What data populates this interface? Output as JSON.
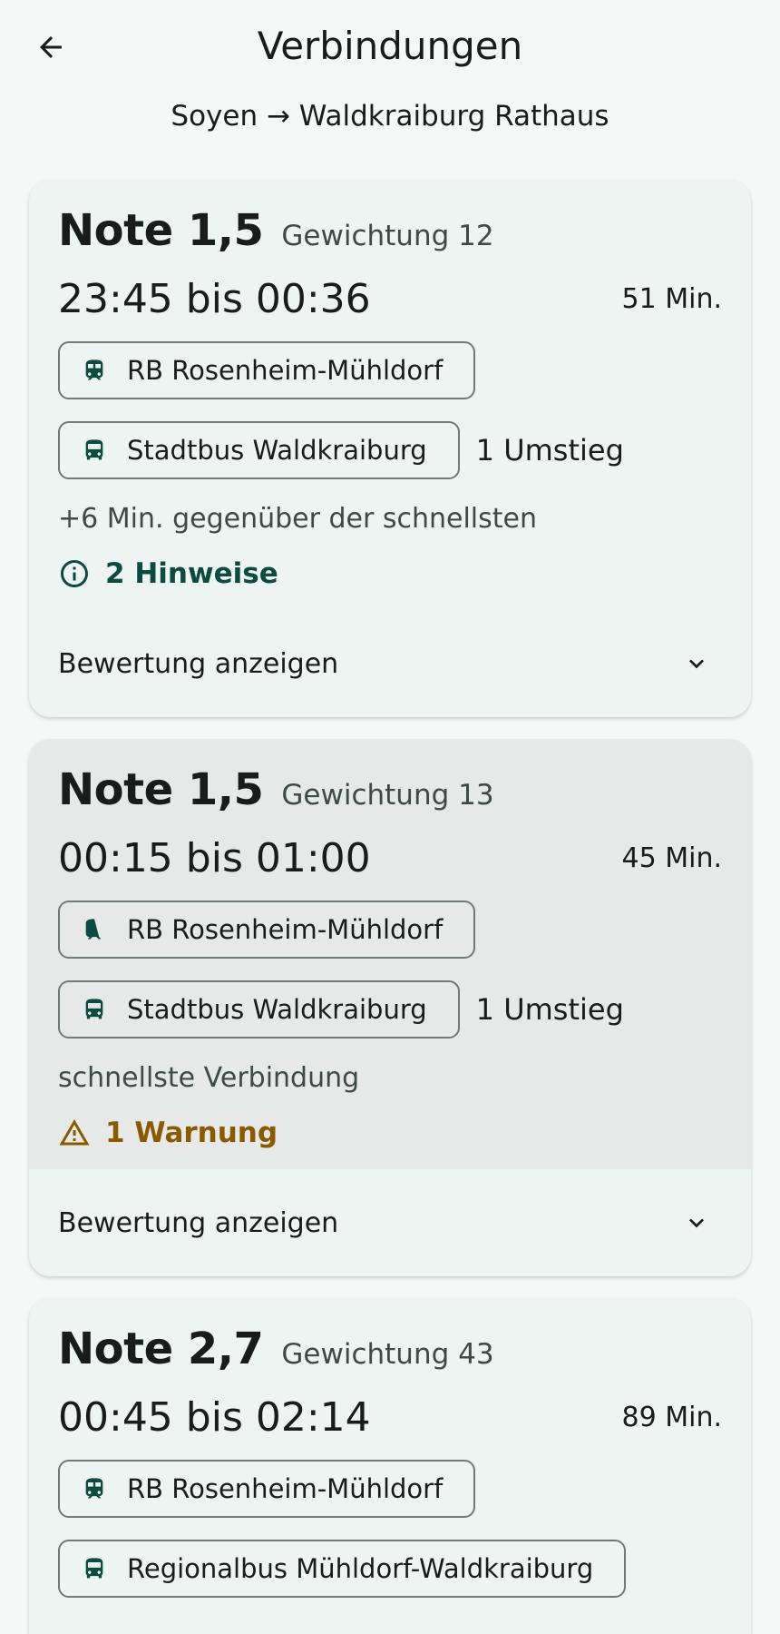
{
  "header": {
    "title": "Verbindungen",
    "route": "Soyen → Waldkraiburg Rathaus"
  },
  "colors": {
    "accent": "#0d4a40",
    "warning": "#8a5a00",
    "card_bg": "#eef4f2",
    "card_highlight_bg": "#e6e9e8"
  },
  "connections": [
    {
      "grade": "Note 1,5",
      "weight": "Gewichtung 12",
      "time": "23:45 bis 00:36",
      "duration": "51 Min.",
      "legs": [
        {
          "icon": "train-icon",
          "label": "RB Rosenheim-Mühldorf"
        },
        {
          "icon": "bus-icon",
          "label": "Stadtbus Waldkraiburg"
        }
      ],
      "transfers": "1 Umstieg",
      "note": "+6 Min. gegenüber der schnellsten",
      "hint": {
        "type": "info",
        "icon": "info-icon",
        "label": "2 Hinweise"
      },
      "expand_label": "Bewertung anzeigen"
    },
    {
      "grade": "Note 1,5",
      "weight": "Gewichtung 13",
      "time": "00:15 bis 01:00",
      "duration": "45 Min.",
      "legs": [
        {
          "icon": "train-icon",
          "label": "RB Rosenheim-Mühldorf"
        },
        {
          "icon": "bus-icon",
          "label": "Stadtbus Waldkraiburg"
        }
      ],
      "transfers": "1 Umstieg",
      "note": "schnellste Verbindung",
      "hint": {
        "type": "warn",
        "icon": "warning-icon",
        "label": "1 Warnung"
      },
      "expand_label": "Bewertung anzeigen"
    },
    {
      "grade": "Note 2,7",
      "weight": "Gewichtung 43",
      "time": "00:45 bis 02:14",
      "duration": "89 Min.",
      "legs": [
        {
          "icon": "train-icon",
          "label": "RB Rosenheim-Mühldorf"
        },
        {
          "icon": "bus-icon",
          "label": "Regionalbus Mühldorf-Waldkraiburg"
        }
      ]
    }
  ]
}
